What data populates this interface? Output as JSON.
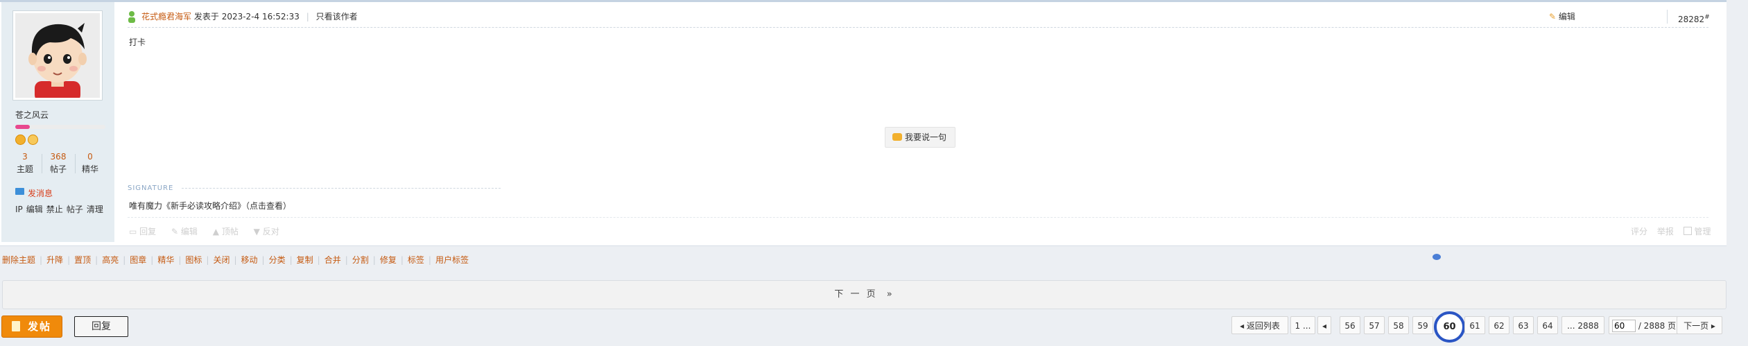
{
  "post": {
    "author": "花式瘾君海军",
    "posted_prefix": "发表于",
    "posted_time": "2023-2-4 16:52:33",
    "only_author": "只看该作者",
    "edit": "编辑",
    "floor": "28282",
    "floor_mark": "#",
    "content": "打卡",
    "comment_button": "我要说一句",
    "signature_label": "SIGNATURE",
    "signature": "唯有魔力《新手必读攻略介绍》（点击查看）",
    "actions": [
      "回复",
      "编辑",
      "顶帖",
      "反对"
    ],
    "right_actions": [
      "评分",
      "举报",
      "管理"
    ]
  },
  "user": {
    "name": "苍之风云",
    "level_fraction": 0.16,
    "stats": [
      {
        "value": "3",
        "label": "主题"
      },
      {
        "value": "368",
        "label": "帖子"
      },
      {
        "value": "0",
        "label": "精华"
      }
    ],
    "send_message": "发消息",
    "admin_links": [
      "IP",
      "编辑",
      "禁止",
      "帖子",
      "清理"
    ],
    "colors": {
      "level": "#e8488e",
      "medal": "#f2b02d"
    }
  },
  "mod_toolbar": [
    "删除主题",
    "升降",
    "置顶",
    "高亮",
    "图章",
    "精华",
    "图标",
    "关闭",
    "移动",
    "分类",
    "复制",
    "合并",
    "分割",
    "修复",
    "标签",
    "用户标签"
  ],
  "next_page": "下 一 页",
  "next_arrow": "»",
  "buttons": {
    "post": "发帖",
    "reply": "回复"
  },
  "pager": {
    "back": "返回列表",
    "first": "1 ...",
    "pages": [
      "56",
      "57",
      "58",
      "59",
      "60",
      "61",
      "62",
      "63",
      "64"
    ],
    "current": "60",
    "last": "... 2888",
    "input_value": "60",
    "total": "/ 2888 页",
    "next": "下一页"
  }
}
